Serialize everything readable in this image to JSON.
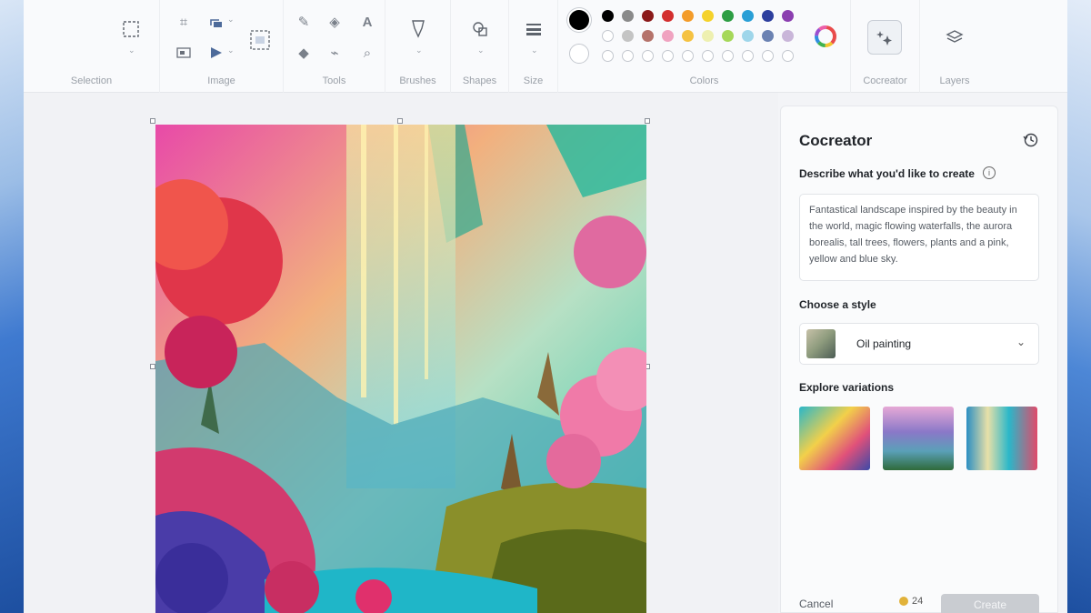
{
  "toolbar": {
    "groups": {
      "selection": "Selection",
      "image": "Image",
      "tools": "Tools",
      "brushes": "Brushes",
      "shapes": "Shapes",
      "size": "Size",
      "colors": "Colors",
      "cocreator": "Cocreator",
      "layers": "Layers"
    },
    "icons": {
      "selection": "selection-rectangle-icon",
      "crop": "crop-icon",
      "resize": "resize-icon",
      "rotate": "rotate-icon",
      "flip": "flip-icon",
      "image_select": "image-select-icon",
      "pencil": "pencil-icon",
      "fill": "fill-bucket-icon",
      "text": "text-icon",
      "eraser": "eraser-icon",
      "picker": "color-picker-icon",
      "magnifier": "magnifier-icon",
      "brush": "brush-icon",
      "shapes": "shapes-icon",
      "size": "line-size-icon",
      "edit_colors": "edit-colors-icon",
      "cocreator": "cocreator-icon",
      "layers": "layers-icon"
    },
    "primary_color": "#000000",
    "secondary_color": "#ffffff",
    "palette_row1": [
      "#000000",
      "#8a8a8a",
      "#8b1a1a",
      "#d32f2f",
      "#f39c2a",
      "#f5d22b",
      "#2e9e44",
      "#2a9fd6",
      "#2d3f9e",
      "#8b3fb0"
    ],
    "palette_row2": [
      "#ffffff",
      "#c4c4c4",
      "#b5736b",
      "#f0a3c0",
      "#f5c242",
      "#eef0b0",
      "#a6d85a",
      "#9fd6ea",
      "#6b82b2",
      "#c9b6d9"
    ]
  },
  "panel": {
    "title": "Cocreator",
    "describe_label": "Describe what you'd like to create",
    "prompt": "Fantastical landscape inspired by the beauty in the world, magic flowing waterfalls, the aurora borealis, tall trees, flowers, plants and a pink, yellow and blue sky.",
    "style_label": "Choose a style",
    "style_value": "Oil painting",
    "variations_label": "Explore variations",
    "cancel": "Cancel",
    "credits": "24",
    "create": "Create"
  }
}
